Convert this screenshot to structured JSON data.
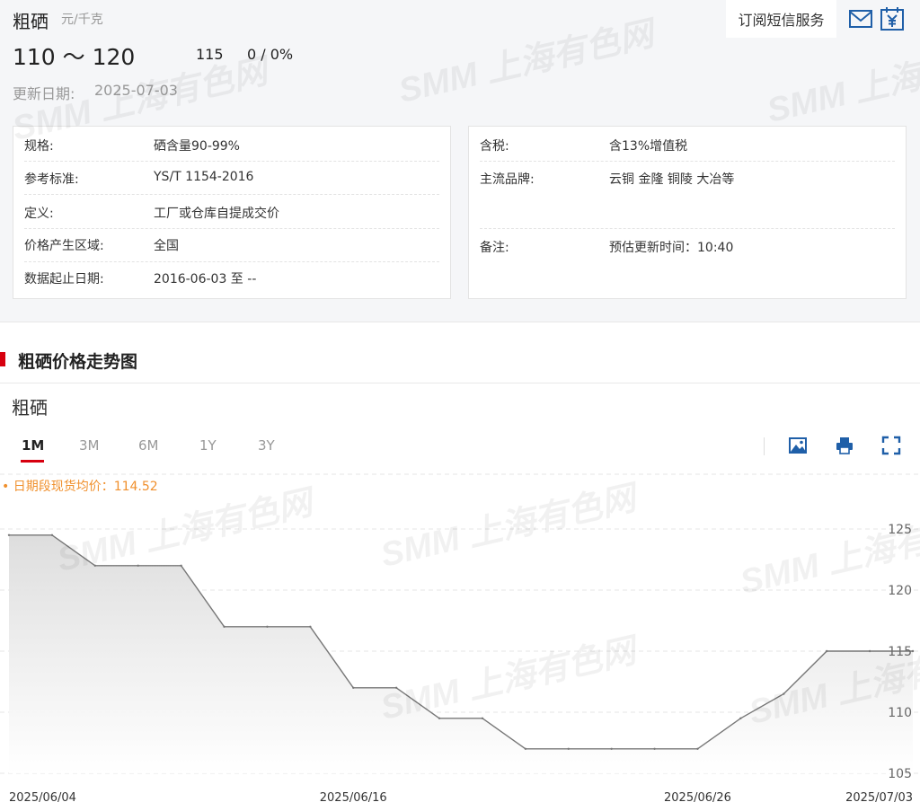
{
  "product": {
    "name": "粗硒",
    "unit": "元/千克",
    "price_range": "110 ～ 120",
    "avg_price": "115",
    "change": "0 / 0%",
    "update_label": "更新日期:",
    "update_date": "2025-07-03"
  },
  "header_actions": {
    "subscribe_label": "订阅短信服务",
    "mail_icon": "mail-icon",
    "price_icon": "yuan-calendar-icon"
  },
  "specs_left": [
    {
      "key": "规格:",
      "value": "硒含量90-99%"
    },
    {
      "key": "参考标准:",
      "value": "YS/T 1154-2016"
    },
    {
      "key": "定义:",
      "value": "工厂或仓库自提成交价"
    },
    {
      "key": "价格产生区域:",
      "value": "全国"
    },
    {
      "key": "数据起止日期:",
      "value": "2016-06-03 至 --"
    }
  ],
  "specs_right": [
    {
      "key": "含税:",
      "value": "含13%增值税"
    },
    {
      "key": "主流品牌:",
      "value": "云铜 金隆 铜陵 大冶等"
    },
    {
      "key": "备注:",
      "value": "预估更新时间：10:40"
    }
  ],
  "section": {
    "title": "粗硒价格走势图",
    "chart_name": "粗硒"
  },
  "tabs": [
    {
      "label": "1M",
      "active": true
    },
    {
      "label": "3M",
      "active": false
    },
    {
      "label": "6M",
      "active": false
    },
    {
      "label": "1Y",
      "active": false
    },
    {
      "label": "3Y",
      "active": false
    }
  ],
  "tools": [
    "image-icon",
    "print-icon",
    "fullscreen-icon"
  ],
  "avg_note": "• 日期段现货均价：114.52",
  "watermark": "SMM 上海有色网",
  "colors": {
    "accent": "#d7000f",
    "avg_note": "#f0902d",
    "line": "#777777",
    "area_top": "#dedede",
    "icon_blue": "#1f5fa8"
  },
  "chart_data": {
    "type": "area",
    "title": "",
    "xlabel": "",
    "ylabel": "",
    "ylim": [
      105,
      125
    ],
    "yticks": [
      105,
      110,
      115,
      120,
      125
    ],
    "y_axis_position": "right",
    "grid": true,
    "x_tick_labels": [
      "2025/06/04",
      "2025/06/16",
      "2025/06/26",
      "2025/07/03"
    ],
    "x": [
      "2025/06/04",
      "2025/06/05",
      "2025/06/06",
      "2025/06/09",
      "2025/06/10",
      "2025/06/11",
      "2025/06/12",
      "2025/06/13",
      "2025/06/16",
      "2025/06/17",
      "2025/06/18",
      "2025/06/19",
      "2025/06/20",
      "2025/06/23",
      "2025/06/24",
      "2025/06/25",
      "2025/06/26",
      "2025/06/27",
      "2025/06/30",
      "2025/07/01",
      "2025/07/02",
      "2025/07/03"
    ],
    "values": [
      124.5,
      124.5,
      122.0,
      122.0,
      122.0,
      117.0,
      117.0,
      117.0,
      112.0,
      112.0,
      109.5,
      109.5,
      107.0,
      107.0,
      107.0,
      107.0,
      107.0,
      109.5,
      111.5,
      115.0,
      115.0,
      115.0
    ]
  }
}
